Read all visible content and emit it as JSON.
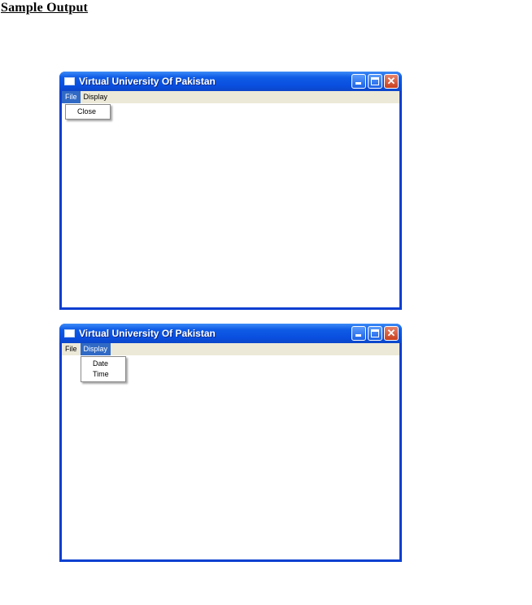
{
  "heading": "Sample Output",
  "windows": [
    {
      "title": "Virtual University Of Pakistan",
      "menu": [
        "File",
        "Display"
      ],
      "open_menu": "File",
      "dropdown_items": [
        "Close"
      ]
    },
    {
      "title": "Virtual University Of Pakistan",
      "menu": [
        "File",
        "Display"
      ],
      "open_menu": "Display",
      "dropdown_items": [
        "Date",
        "Time"
      ]
    }
  ]
}
